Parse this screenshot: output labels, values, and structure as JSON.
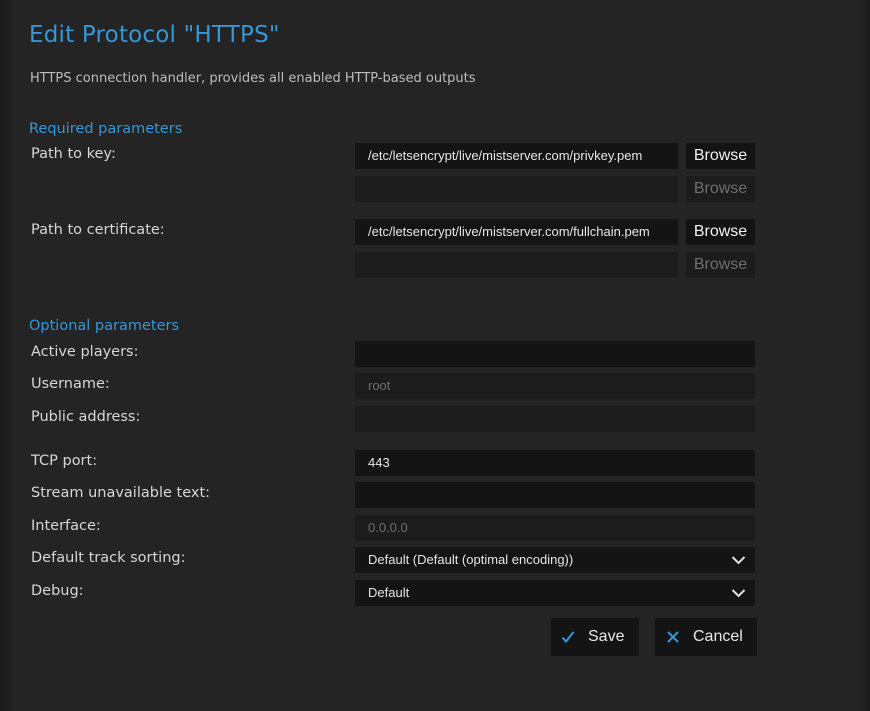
{
  "header": {
    "title": "Edit Protocol \"HTTPS\"",
    "description": "HTTPS connection handler, provides all enabled HTTP-based outputs"
  },
  "required": {
    "heading": "Required parameters",
    "key_label": "Path to key:",
    "key_values": [
      "/etc/letsencrypt/live/mistserver.com/privkey.pem",
      ""
    ],
    "cert_label": "Path to certificate:",
    "cert_values": [
      "/etc/letsencrypt/live/mistserver.com/fullchain.pem",
      ""
    ],
    "browse_label": "Browse"
  },
  "optional": {
    "heading": "Optional parameters",
    "active_players_label": "Active players:",
    "active_players_value": "",
    "username_label": "Username:",
    "username_placeholder": "root",
    "public_address_label": "Public address:",
    "public_address_value": "",
    "tcp_port_label": "TCP port:",
    "tcp_port_value": "443",
    "stream_unavailable_label": "Stream unavailable text:",
    "stream_unavailable_value": "",
    "interface_label": "Interface:",
    "interface_placeholder": "0.0.0.0",
    "track_sorting_label": "Default track sorting:",
    "track_sorting_value": "Default (Default (optimal encoding))",
    "debug_label": "Debug:",
    "debug_value": "Default"
  },
  "actions": {
    "save_label": "Save",
    "cancel_label": "Cancel",
    "save_icon": "check-icon",
    "cancel_icon": "x-icon"
  },
  "colors": {
    "accent": "#3597d6",
    "background": "#242424",
    "field_background": "#141414"
  }
}
